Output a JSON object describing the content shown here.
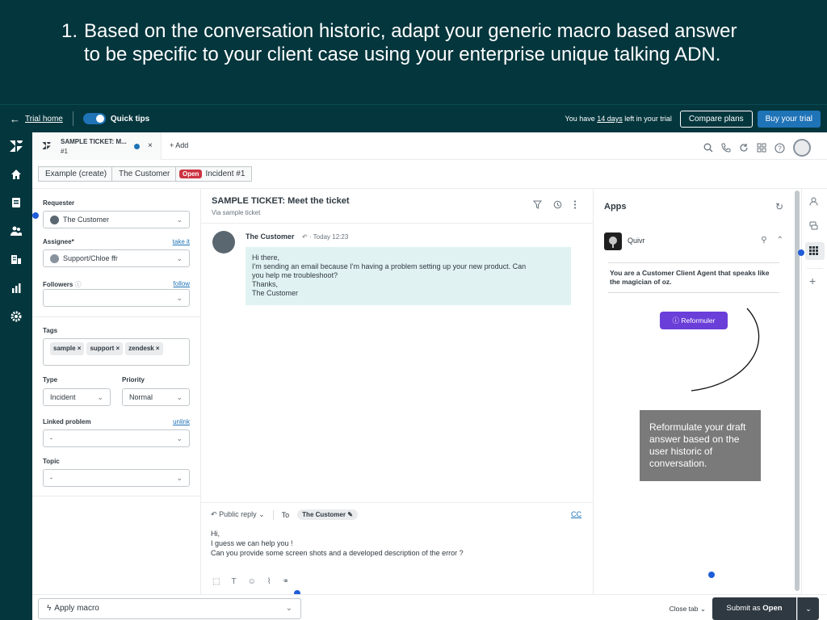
{
  "banner": {
    "number": "1.",
    "text": "Based on the conversation historic, adapt your generic macro based answer to be specific to your client case using your enterprise unique talking ADN."
  },
  "trial_bar": {
    "back_label": "Trial home",
    "quick_tips": "Quick tips",
    "days_prefix": "You have",
    "days": "14 days",
    "days_suffix": "left in your trial",
    "compare": "Compare plans",
    "buy": "Buy your trial"
  },
  "ticket_tab": {
    "title": "SAMPLE TICKET: M...",
    "sub": "#1",
    "close": "×",
    "add": "+ Add"
  },
  "breadcrumbs": {
    "example": "Example (create)",
    "customer": "The Customer",
    "status": "Open",
    "incident": "Incident #1"
  },
  "properties": {
    "requester_label": "Requester",
    "requester_value": "The Customer",
    "assignee_label": "Assignee*",
    "take_it": "take it",
    "assignee_value": "Support/Chloe ffr",
    "followers_label": "Followers",
    "follow": "follow",
    "tags_label": "Tags",
    "tags": [
      "sample ×",
      "support ×",
      "zendesk ×"
    ],
    "type_label": "Type",
    "type_value": "Incident",
    "priority_label": "Priority",
    "priority_value": "Normal",
    "linked_label": "Linked problem",
    "unlink": "unlink",
    "linked_value": "-",
    "topic_label": "Topic",
    "topic_value": "-"
  },
  "conversation": {
    "title": "SAMPLE TICKET: Meet the ticket",
    "via": "Via sample ticket",
    "author": "The Customer",
    "time": "· Today 12:23",
    "lines": [
      "Hi there,",
      "I'm sending an email because I'm having a problem setting up your new product. Can",
      "you help me troubleshoot?",
      "Thanks,",
      "The Customer"
    ]
  },
  "composer": {
    "mode": "Public reply",
    "to_label": "To",
    "to_chip": "The Customer",
    "cc": "CC",
    "lines": [
      "Hi,",
      "I guess we can help you !",
      "Can you provide some screen shots and a developed description of the error ?"
    ]
  },
  "apps": {
    "title": "Apps",
    "app_name": "Quivr",
    "prompt": "You are a Customer Client Agent that speaks like the magician of oz.",
    "button": "Reformuler",
    "tooltip": "Reformulate your draft answer based on the user historic of conversation."
  },
  "footer": {
    "macro": "Apply macro",
    "close_tab": "Close tab",
    "submit_prefix": "Submit as",
    "submit_status": "Open"
  },
  "colors": {
    "banner_bg": "#03363d",
    "accent": "#1f73b7",
    "app_button": "#6a3ed8",
    "open_badge": "#cc3340"
  },
  "icons": [
    "back-arrow-icon",
    "zendesk-logo-icon",
    "home-icon",
    "views-icon",
    "customers-icon",
    "organizations-icon",
    "reporting-icon",
    "settings-icon",
    "search-icon",
    "phone-icon",
    "refresh-icon",
    "apps-grid-icon",
    "help-icon",
    "filter-icon",
    "history-icon",
    "more-icon",
    "pin-icon",
    "chevron-up-icon",
    "user-icon",
    "chat-icon",
    "plus-icon"
  ]
}
